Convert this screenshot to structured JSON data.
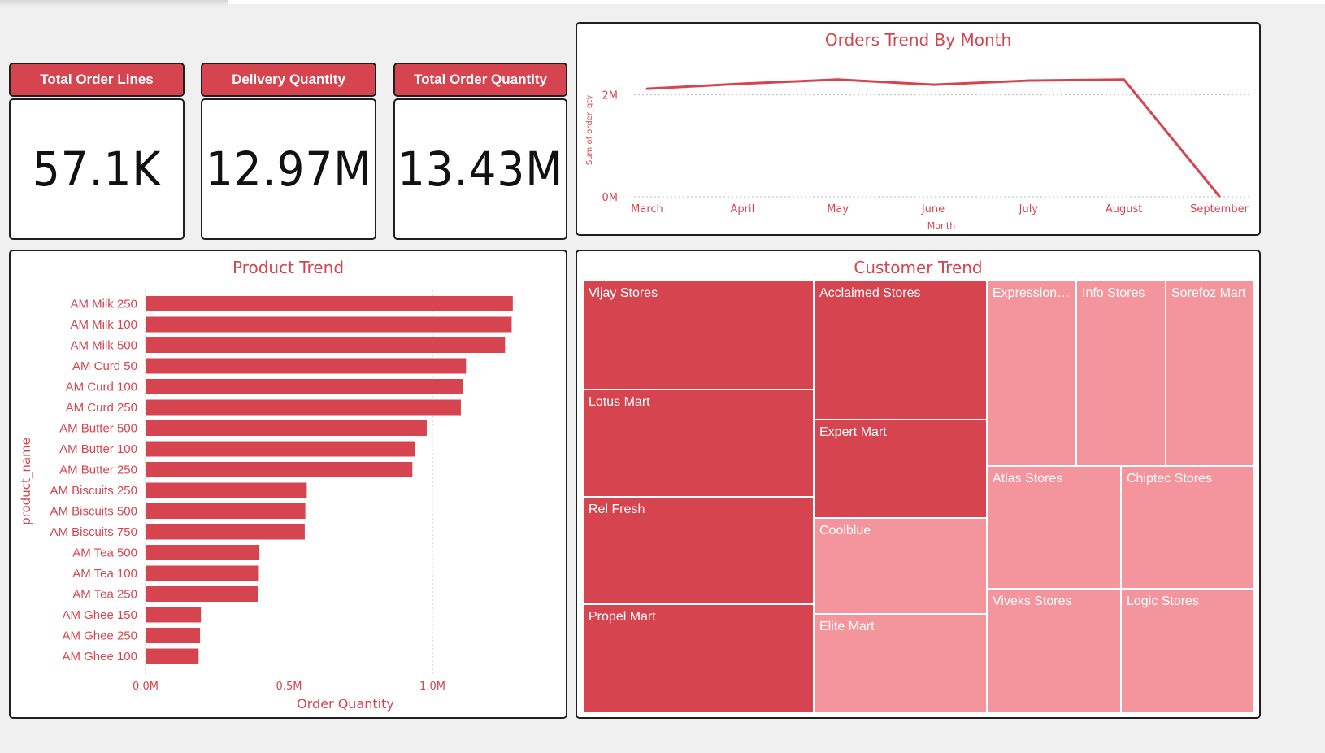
{
  "kpis": [
    {
      "label": "Total Order Lines",
      "value": "57.1K"
    },
    {
      "label": "Delivery Quantity",
      "value": "12.97M"
    },
    {
      "label": "Total Order Quantity",
      "value": "13.43M"
    }
  ],
  "colors": {
    "accent": "#d6444f",
    "light": "#f4959d",
    "grid": "#bdbdbd",
    "text": "#d6444f"
  },
  "chart_data": [
    {
      "type": "line",
      "title": "Orders Trend By Month",
      "xlabel": "Month",
      "ylabel": "Sum of order_qty",
      "x": [
        "March",
        "April",
        "May",
        "June",
        "July",
        "August",
        "September"
      ],
      "y_ticks": [
        {
          "value": 0,
          "label": "0M"
        },
        {
          "value": 2000000,
          "label": "2M"
        }
      ],
      "ylim": [
        0,
        2600000
      ],
      "series": [
        {
          "values": [
            2120000,
            2220000,
            2300000,
            2200000,
            2280000,
            2300000,
            10000
          ]
        }
      ],
      "grid": true
    },
    {
      "type": "bar",
      "orientation": "horizontal",
      "title": "Product Trend",
      "xlabel": "Order Quantity",
      "ylabel": "product_name",
      "categories": [
        "AM Milk 250",
        "AM Milk 100",
        "AM Milk 500",
        "AM Curd 50",
        "AM Curd 100",
        "AM Curd 250",
        "AM Butter 500",
        "AM Butter 100",
        "AM Butter 250",
        "AM Biscuits 250",
        "AM Biscuits 500",
        "AM Biscuits 750",
        "AM Tea 500",
        "AM Tea 100",
        "AM Tea 250",
        "AM Ghee 150",
        "AM Ghee 250",
        "AM Ghee 100"
      ],
      "values": [
        1280000,
        1276000,
        1253000,
        1117000,
        1105000,
        1099000,
        980000,
        940000,
        930000,
        562000,
        557000,
        555000,
        397000,
        395000,
        392000,
        193000,
        190000,
        185000
      ],
      "x_ticks": [
        {
          "value": 0,
          "label": "0.0M"
        },
        {
          "value": 500000,
          "label": "0.5M"
        },
        {
          "value": 1000000,
          "label": "1.0M"
        }
      ],
      "xlim": [
        0,
        1000000
      ],
      "grid": true
    },
    {
      "type": "treemap",
      "title": "Customer Trend",
      "items": [
        {
          "name": "Vijay Stores",
          "shade": "dark"
        },
        {
          "name": "Lotus Mart",
          "shade": "dark"
        },
        {
          "name": "Rel Fresh",
          "shade": "dark"
        },
        {
          "name": "Propel Mart",
          "shade": "dark"
        },
        {
          "name": "Acclaimed Stores",
          "shade": "dark"
        },
        {
          "name": "Expert Mart",
          "shade": "dark"
        },
        {
          "name": "Coolblue",
          "shade": "light"
        },
        {
          "name": "Elite Mart",
          "shade": "light"
        },
        {
          "name": "Expression ...",
          "shade": "light"
        },
        {
          "name": "Info Stores",
          "shade": "light"
        },
        {
          "name": "Sorefoz Mart",
          "shade": "light"
        },
        {
          "name": "Atlas Stores",
          "shade": "light"
        },
        {
          "name": "Chiptec Stores",
          "shade": "light"
        },
        {
          "name": "Viveks Stores",
          "shade": "light"
        },
        {
          "name": "Logic Stores",
          "shade": "light"
        }
      ]
    }
  ]
}
